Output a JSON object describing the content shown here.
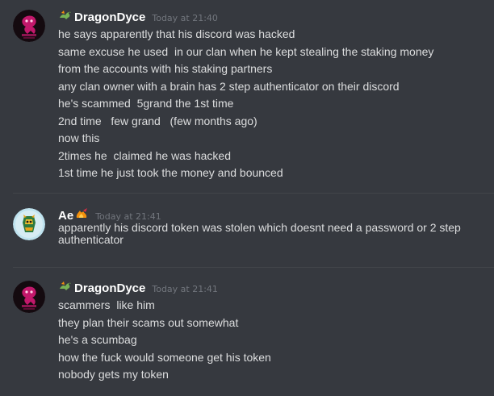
{
  "messages": [
    {
      "author": "DragonDyce",
      "timestamp": "Today at 21:40",
      "lines": [
        "he says apparently that his discord was hacked",
        "same excuse he used  in our clan when he kept stealing the staking money",
        "from the accounts with his staking partners",
        "any clan owner with a brain has 2 step authenticator on their discord",
        "he's scammed  5grand the 1st time",
        "2nd time   few grand   (few months ago)",
        "now this",
        "2times he  claimed he was hacked",
        "1st time he just took the money and bounced"
      ]
    },
    {
      "author": "Ae",
      "timestamp": "Today at 21:41",
      "lines": [
        "apparently his discord token was stolen which doesnt need a password or 2 step",
        "authenticator"
      ]
    },
    {
      "author": "DragonDyce",
      "timestamp": "Today at 21:41",
      "lines": [
        "scammers  like him",
        "they plan their scams out somewhat",
        "he's a scumbag",
        "how the fuck would someone get his token",
        "nobody gets my token"
      ]
    }
  ],
  "colors": {
    "background": "#36393f",
    "username": "#ffffff",
    "message_text": "#dcddde",
    "timestamp": "#72767d",
    "divider": "#42454a"
  },
  "icons": {
    "dragon_badge": "dragon-emoji-icon",
    "ae_badge": "fire-emoji-icon"
  }
}
